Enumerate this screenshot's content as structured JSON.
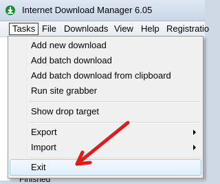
{
  "window": {
    "title": "Internet Download Manager 6.05"
  },
  "menubar": {
    "items": [
      "Tasks",
      "File",
      "Downloads",
      "View",
      "Help",
      "Registratio"
    ]
  },
  "tasks_menu": {
    "items": [
      "Add new download",
      "Add batch download",
      "Add batch download from clipboard",
      "Run site grabber",
      "Show drop target",
      "Export",
      "Import",
      "Exit"
    ]
  },
  "background": {
    "bottom_label": "Finished",
    "right_fragments": [
      "S",
      "S",
      "B"
    ]
  },
  "annotation": {
    "arrow_color": "#e01b1b"
  }
}
